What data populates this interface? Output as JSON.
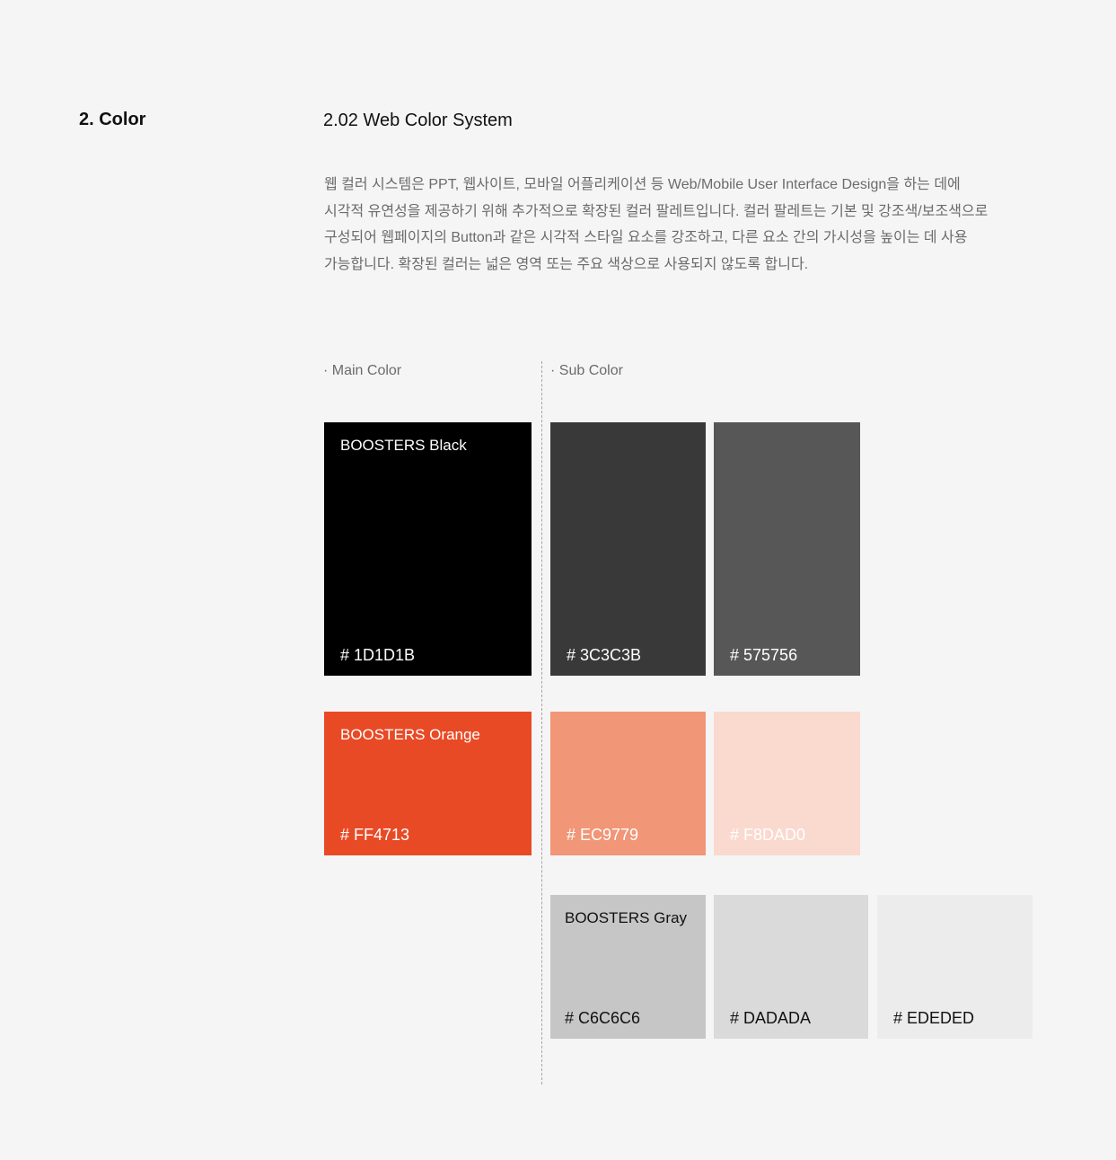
{
  "section": {
    "title": "2. Color"
  },
  "subsection": {
    "title": "2.02  Web Color System"
  },
  "description": [
    "웹 컬러 시스템은 PPT, 웹사이트, 모바일 어플리케이션 등 Web/Mobile User Interface Design을 하는 데에",
    "시각적 유연성을 제공하기 위해 추가적으로 확장된 컬러 팔레트입니다. 컬러 팔레트는 기본 및 강조색/보조색으로",
    "구성되어 웹페이지의 Button과 같은 시각적 스타일 요소를 강조하고, 다른 요소 간의 가시성을 높이는 데 사용",
    "가능합니다. 확장된 컬러는 넓은 영역 또는 주요 색상으로 사용되지 않도록 합니다."
  ],
  "labels": {
    "main": "· Main Color",
    "sub": "· Sub Color"
  },
  "main_colors": {
    "black": {
      "name": "BOOSTERS Black",
      "hex": "# 1D1D1B",
      "color": "#000000"
    },
    "orange": {
      "name": "BOOSTERS Orange",
      "hex": "# FF4713",
      "color": "#e84a26"
    }
  },
  "sub_colors": {
    "dark1": {
      "hex": "# 3C3C3B",
      "color": "#393939"
    },
    "dark2": {
      "hex": "# 575756",
      "color": "#585757"
    },
    "orange1": {
      "hex": "# EC9779",
      "color": "#f19677"
    },
    "orange2": {
      "hex": "# F8DAD0",
      "color": "#fad9cf"
    },
    "gray1": {
      "name": "BOOSTERS Gray",
      "hex": "# C6C6C6",
      "color": "#c6c6c6"
    },
    "gray2": {
      "hex": "# DADADA",
      "color": "#dadada"
    },
    "gray3": {
      "hex": "# EDEDED",
      "color": "#ececec"
    }
  }
}
